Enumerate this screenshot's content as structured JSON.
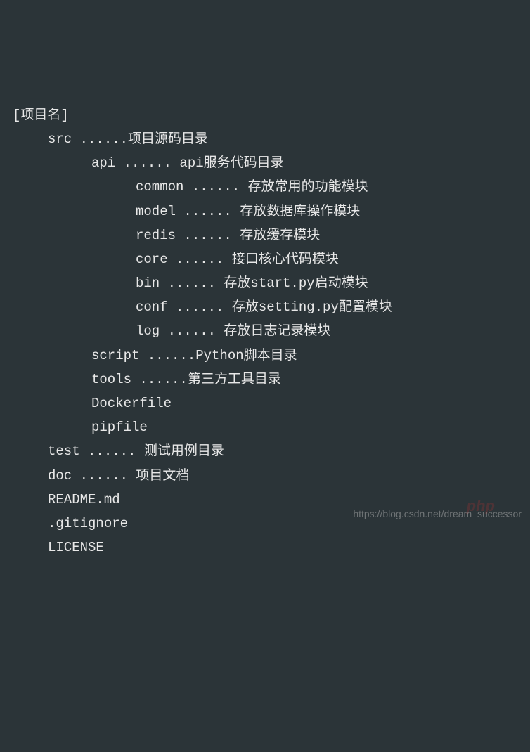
{
  "lines": [
    {
      "indent": 0,
      "text": "[项目名]"
    },
    {
      "indent": 1,
      "text": "src ......项目源码目录"
    },
    {
      "indent": 2,
      "text": "api ...... api服务代码目录"
    },
    {
      "indent": 3,
      "text": "common ...... 存放常用的功能模块"
    },
    {
      "indent": 3,
      "text": "model ...... 存放数据库操作模块"
    },
    {
      "indent": 3,
      "text": "redis ...... 存放缓存模块"
    },
    {
      "indent": 3,
      "text": "core ...... 接口核心代码模块"
    },
    {
      "indent": 3,
      "text": "bin ...... 存放start.py启动模块"
    },
    {
      "indent": 3,
      "text": "conf ...... 存放setting.py配置模块"
    },
    {
      "indent": 3,
      "text": "log ...... 存放日志记录模块"
    },
    {
      "indent": 2,
      "text": "script ......Python脚本目录"
    },
    {
      "indent": 2,
      "text": "tools ......第三方工具目录"
    },
    {
      "indent": 2,
      "text": "Dockerfile"
    },
    {
      "indent": 2,
      "text": "pipfile"
    },
    {
      "indent": 1,
      "text": "test ...... 测试用例目录"
    },
    {
      "indent": 1,
      "text": "doc ...... 项目文档"
    },
    {
      "indent": 1,
      "text": "README.md"
    },
    {
      "indent": 1,
      "text": ".gitignore"
    },
    {
      "indent": 1,
      "text": "LICENSE"
    }
  ],
  "watermark_logo": "php",
  "watermark": "https://blog.csdn.net/dream_successor"
}
